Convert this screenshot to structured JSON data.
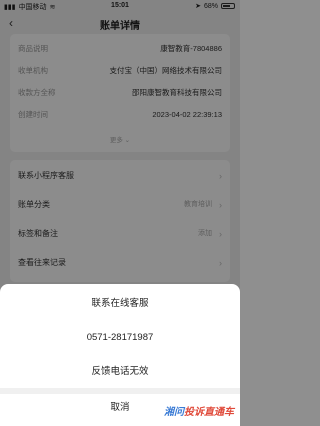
{
  "status_bar": {
    "carrier": "中国移动",
    "time": "15:01",
    "battery": "68%",
    "battery_level": 0.68
  },
  "header": {
    "title": "账单详情"
  },
  "details": [
    {
      "label": "商品说明",
      "value": "康智教育-7804886"
    },
    {
      "label": "收单机构",
      "value": "支付宝（中国）网络技术有限公司"
    },
    {
      "label": "收款方全称",
      "value": "邵阳康智教育科技有限公司"
    },
    {
      "label": "创建时间",
      "value": "2023-04-02 22:39:13"
    }
  ],
  "more_label": "更多",
  "menu": [
    {
      "label": "联系小程序客服",
      "value": ""
    },
    {
      "label": "账单分类",
      "value": "教育培训"
    },
    {
      "label": "标签和备注",
      "value": "添加"
    },
    {
      "label": "查看往来记录",
      "value": ""
    }
  ],
  "sheet": {
    "options": [
      "联系在线客服",
      "0571-28171987",
      "反馈电话无效"
    ],
    "cancel": "取消"
  },
  "watermark": {
    "part1": "湘问",
    "part2": "投诉直通车"
  }
}
